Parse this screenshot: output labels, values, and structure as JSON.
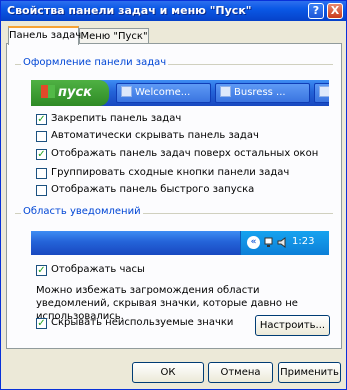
{
  "window": {
    "title": "Свойства панели задач и меню \"Пуск\""
  },
  "title_buttons": {
    "help": "?",
    "close": "X"
  },
  "tabs": [
    {
      "label": "Панель задач",
      "active": true
    },
    {
      "label": "Меню \"Пуск\"",
      "active": false
    }
  ],
  "taskbar_group": {
    "legend": "Оформление панели задач",
    "preview": {
      "start_label": "пуск",
      "buttons": [
        "Welcome...",
        "Busress ...",
        ""
      ]
    },
    "options": [
      {
        "label": "Закрепить панель задач",
        "checked": true
      },
      {
        "label": "Автоматически скрывать панель задач",
        "checked": false
      },
      {
        "label": "Отображать панель задач поверх остальных окон",
        "checked": true
      },
      {
        "label": "Группировать сходные кнопки панели задач",
        "checked": false
      },
      {
        "label": "Отображать панель быстрого запуска",
        "checked": false
      }
    ]
  },
  "notification_group": {
    "legend": "Область уведомлений",
    "preview": {
      "chevron": "«",
      "clock": "1:23"
    },
    "show_clock": {
      "label": "Отображать часы",
      "checked": true
    },
    "description": "Можно избежать загромождения области уведомлений, скрывая значки, которые давно не использовались.",
    "hide_inactive": {
      "label": "Скрывать неиспользуемые значки",
      "checked": true
    },
    "customize_label": "Настроить..."
  },
  "footer": {
    "ok": "ОК",
    "cancel": "Отмена",
    "apply": "Применить"
  },
  "colors": {
    "accent_blue": "#0046d5",
    "start_green": "#3fa335",
    "taskbar_blue": "#245edb",
    "check_green": "#21a121"
  }
}
